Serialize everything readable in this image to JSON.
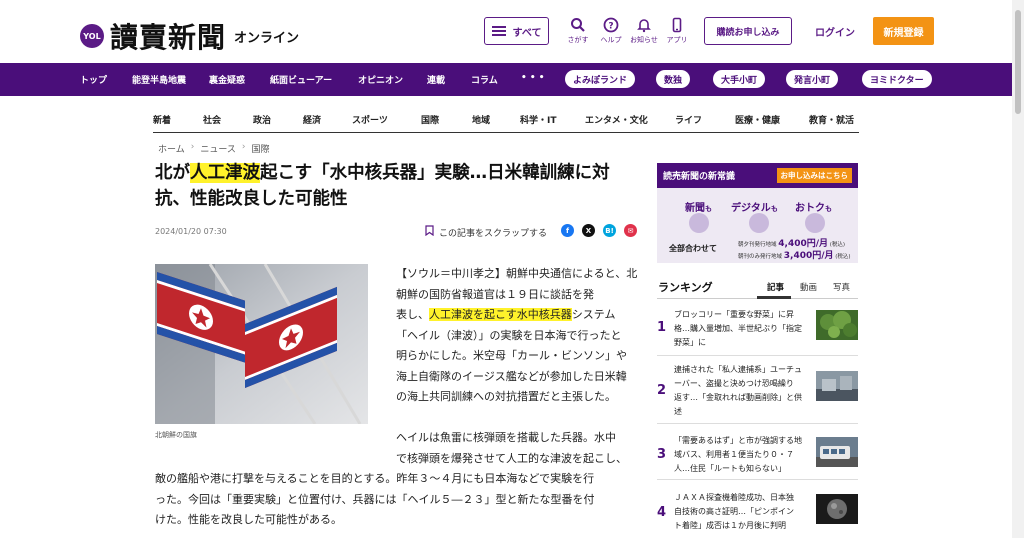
{
  "header": {
    "logo_badge": "YOL",
    "logo_main": "讀賣新聞",
    "logo_sub": "オンライン",
    "menu_label": "すべて",
    "tools": [
      {
        "label": "さがす",
        "icon": "search-icon"
      },
      {
        "label": "ヘルプ",
        "icon": "help-icon"
      },
      {
        "label": "お知らせ",
        "icon": "bell-icon"
      },
      {
        "label": "アプリ",
        "icon": "phone-icon"
      }
    ],
    "subscribe": "購読お申し込み",
    "login": "ログイン",
    "register": "新規登録"
  },
  "purple_nav": {
    "items": [
      "トップ",
      "能登半島地震",
      "裏金疑惑",
      "紙面ビューアー",
      "オピニオン",
      "連載",
      "コラム",
      "• • •"
    ],
    "pills": [
      "よみぽランド",
      "数独",
      "大手小町",
      "発言小町",
      "ヨミドクター"
    ]
  },
  "categories": [
    "新着",
    "社会",
    "政治",
    "経済",
    "スポーツ",
    "国際",
    "地域",
    "科学・IT",
    "エンタメ・文化",
    "ライフ",
    "医療・健康",
    "教育・就活"
  ],
  "breadcrumb": [
    "ホーム",
    "ニュース",
    "国際"
  ],
  "article": {
    "title_pre": "北が",
    "title_hl": "人工津波",
    "title_post": "起こす「水中核兵器」実験…日米韓訓練に対抗、性能改良した可能性",
    "date": "2024/01/20 07:30",
    "scrap": "この記事をスクラップする",
    "share": [
      {
        "name": "facebook",
        "glyph": "f",
        "color": "#1877f2"
      },
      {
        "name": "x",
        "glyph": "X",
        "color": "#111111"
      },
      {
        "name": "hatena",
        "glyph": "B!",
        "color": "#00a4de"
      },
      {
        "name": "mail",
        "glyph": "✉",
        "color": "#e0324b"
      }
    ],
    "caption": "北朝鮮の国旗",
    "p1_lines": [
      "【ソウル＝中川孝之】朝鮮中央通信によると、北朝鮮の国防省報道官は１９日に談話を発",
      "表し、",
      "人工津波を起こす水中核兵器",
      "システム",
      "「ヘイル（津波）」の実験を日本海で行ったと",
      "明らかにした。米空母「カール・ビンソン」や",
      "海上自衛隊のイージス艦などが参加した日米韓",
      "の海上共同訓練への対抗措置だと主張した。"
    ],
    "p2_lines": [
      "ヘイルは魚雷に核弾頭を搭載した兵器。水中",
      "で核弾頭を爆発させて人工的な津波を起こし、",
      "敵の艦船や港に打撃を与えることを目的とする。昨年３～４月にも日本海などで実験を行",
      "った。今回は「重要実験」と位置付け、兵器には「ヘイル５―２３」型と新たな型番を付",
      "けた。性能を改良した可能性がある。"
    ]
  },
  "sidebar": {
    "ad": {
      "title": "読売新聞の新常識",
      "button": "お申し込みはこちら",
      "words": [
        {
          "big": "新聞",
          "small": "も"
        },
        {
          "big": "デジタル",
          "small": "も"
        },
        {
          "big": "おトク",
          "small": "も"
        }
      ],
      "total": "全部合わせて",
      "prices": [
        {
          "area": "朝夕刊発行地域",
          "price": "4,400",
          "unit": "円/月",
          "note": "(税込)"
        },
        {
          "area": "朝刊のみ発行地域",
          "price": "3,400",
          "unit": "円/月",
          "note": "(税込)"
        }
      ]
    },
    "ranking_title": "ランキング",
    "ranking_tabs": [
      "記事",
      "動画",
      "写真"
    ],
    "ranking": [
      {
        "num": "1",
        "lines": [
          "ブロッコリー「重要な野菜」に昇",
          "格…購入量増加、半世紀ぶり「指定",
          "野菜」に"
        ]
      },
      {
        "num": "2",
        "lines": [
          "逮捕された「私人逮捕系」ユーチュ",
          "ーバー、盗撮と決めつけ恐喝繰り",
          "返す…「金取れれば動画削除」と供",
          "述"
        ]
      },
      {
        "num": "3",
        "lines": [
          "「需要あるはず」と市が強調する地",
          "域バス、利用者１便当たり０・７",
          "人…住民「ルートも知らない」"
        ]
      },
      {
        "num": "4",
        "lines": [
          "ＪＡＸＡ探査機着陸成功、日本独",
          "自技術の高さ証明…「ピンポイン",
          "ト着陸」成否は１か月後に判明"
        ]
      }
    ]
  }
}
